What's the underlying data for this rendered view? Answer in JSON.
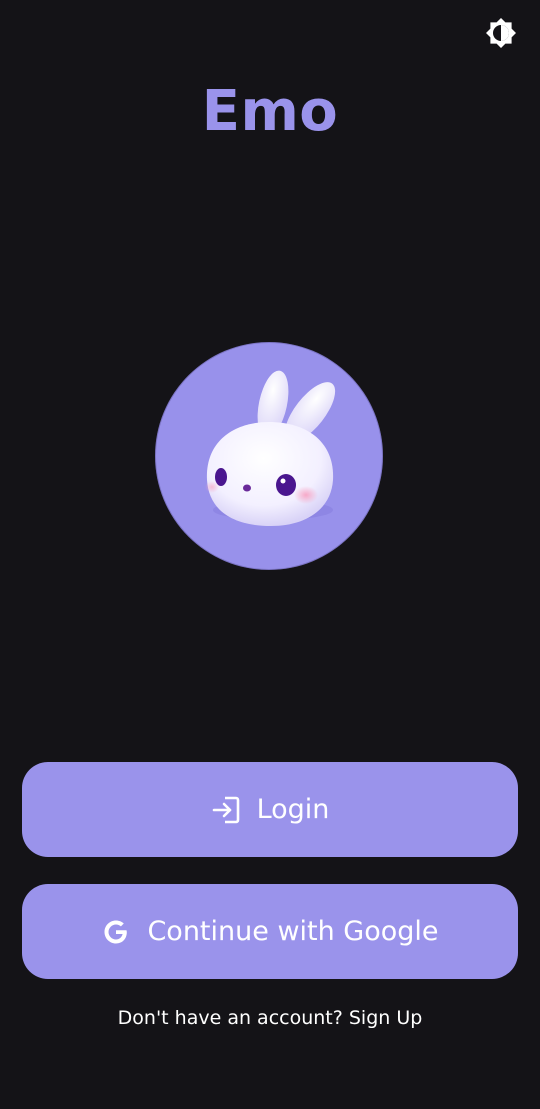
{
  "app": {
    "title": "Emo"
  },
  "header": {
    "theme_toggle_icon": "brightness-contrast-icon"
  },
  "logo": {
    "icon": "bunny-mascot-icon",
    "background_color": "#9891eb"
  },
  "actions": {
    "login_label": "Login",
    "login_icon": "login-arrow-icon",
    "google_label": "Continue with Google",
    "google_icon": "google-g-icon"
  },
  "footer": {
    "prompt": "Don't have an account?",
    "signup_label": "Sign Up"
  },
  "colors": {
    "background": "#141317",
    "accent": "#9a93eb",
    "text": "#ffffff"
  }
}
